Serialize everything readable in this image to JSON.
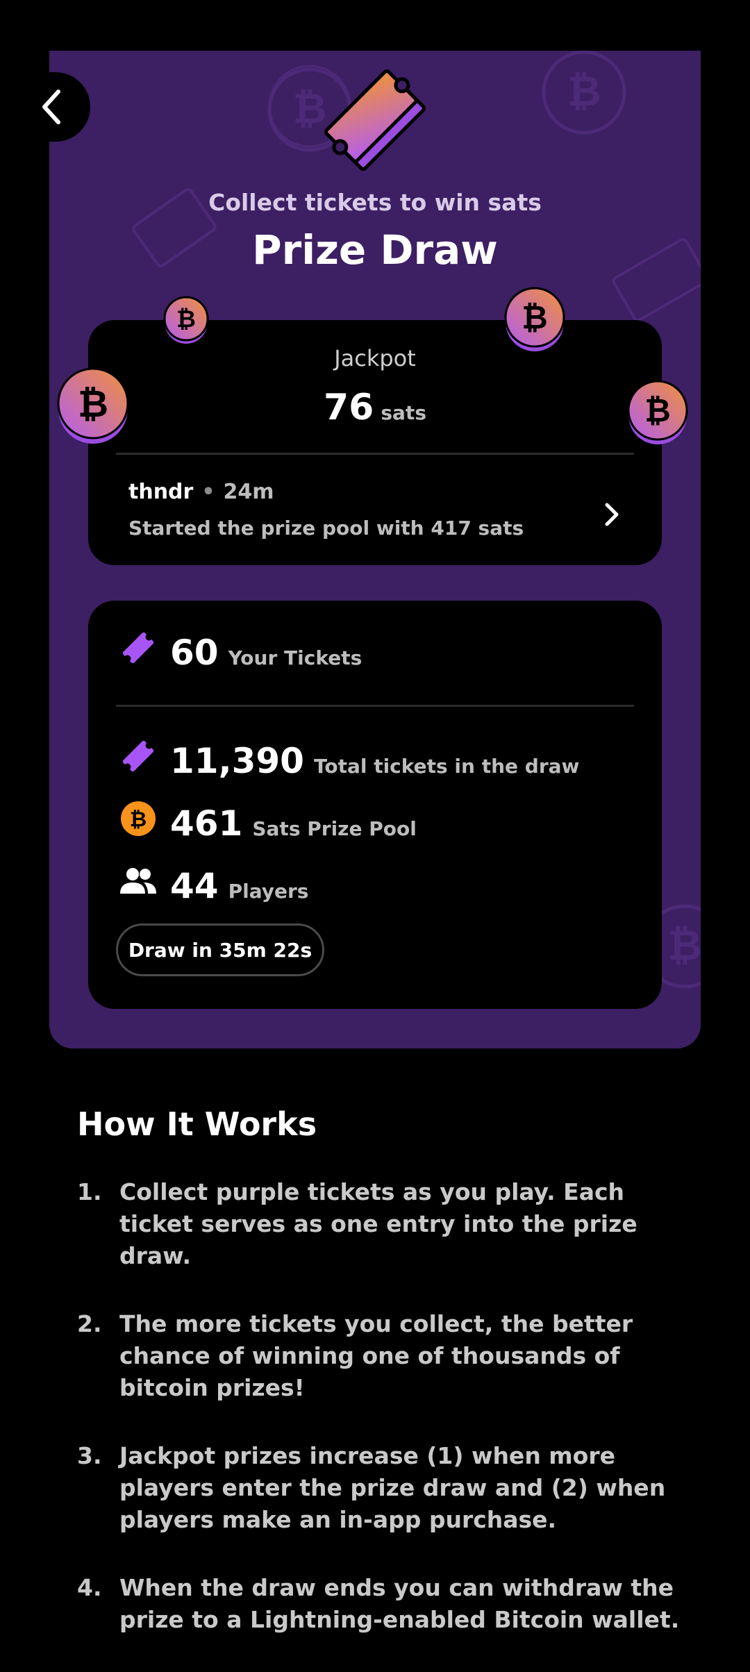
{
  "header": {
    "subtitle": "Collect tickets to win sats",
    "title": "Prize Draw"
  },
  "jackpot": {
    "label": "Jackpot",
    "value": "76",
    "unit": "sats",
    "recent": {
      "user": "thndr",
      "time": "24m",
      "message": "Started the prize pool with 417 sats"
    }
  },
  "stats": {
    "your_tickets": {
      "value": "60",
      "label": "Your Tickets"
    },
    "total_tickets": {
      "value": "11,390",
      "label": "Total tickets in the draw"
    },
    "prize_pool": {
      "value": "461",
      "label": "Sats Prize Pool"
    },
    "players": {
      "value": "44",
      "label": "Players"
    },
    "draw_timer": "Draw in 35m 22s"
  },
  "how_it_works": {
    "title": "How It Works",
    "steps": [
      {
        "num": "1.",
        "text": "Collect purple tickets as you play. Each ticket serves as one entry into the prize draw."
      },
      {
        "num": "2.",
        "text": "The more tickets you collect, the better chance of winning one of thousands of bitcoin prizes!"
      },
      {
        "num": "3.",
        "text": "Jackpot prizes increase (1) when more players enter the prize draw and (2) when players make an in-app purchase."
      },
      {
        "num": "4.",
        "text": "When the draw ends you can withdraw the prize to a Lightning-enabled Bitcoin wallet."
      }
    ]
  },
  "icons": {
    "back": "chevron-left-icon",
    "ticket": "ticket-icon",
    "bitcoin": "bitcoin-icon",
    "players": "people-icon",
    "chevron": "chevron-right-icon"
  },
  "colors": {
    "hero_bg": "#3d1f63",
    "ticket_purple": "#a855f7",
    "bitcoin_orange": "#f7931a"
  }
}
